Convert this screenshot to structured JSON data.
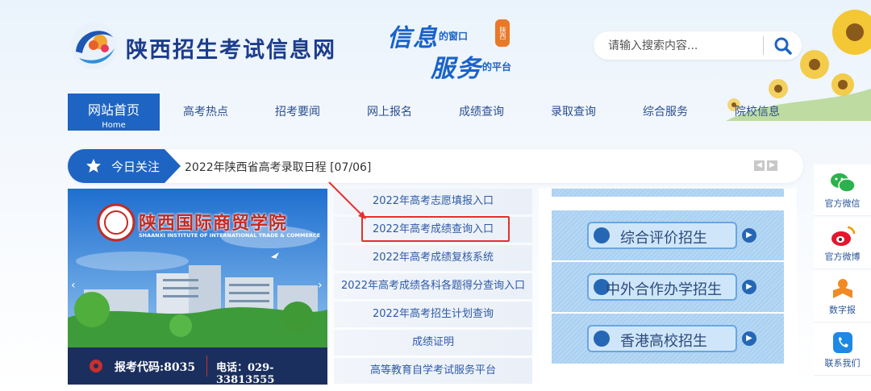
{
  "site": {
    "title": "陕西招生考试信息网",
    "slogan_line1_big": "信息",
    "slogan_line1_small": "的窗口",
    "slogan_line2_big": "服务",
    "slogan_line2_small": "的平台",
    "slogan_seal": "陕西"
  },
  "search": {
    "placeholder": "请输入搜索内容..."
  },
  "nav": {
    "home_cn": "网站首页",
    "home_en": "Home",
    "items": [
      "高考热点",
      "招考要闻",
      "网上报名",
      "成绩查询",
      "录取查询",
      "综合服务",
      "院校信息"
    ]
  },
  "focus": {
    "label": "今日关注",
    "news": "2022年陕西省高考录取日程  [07/06]"
  },
  "banner": {
    "school_cn": "陕西国际商贸学院",
    "school_en": "SHAANXI INSTITUTE OF INTERNATIONAL TRADE & COMMERCE",
    "code_text": "报考代码:8035",
    "phone_text": "电话：029-33813555"
  },
  "links": [
    "2022年高考志愿填报入口",
    "2022年高考成绩查询入口",
    "2022年高考成绩复核系统",
    "2022年高考成绩各科各题得分查询入口",
    "2022年高考招生计划查询",
    "成绩证明",
    "高等教育自学考试服务平台"
  ],
  "right_panel": {
    "buttons": [
      "综合评价招生",
      "中外合作办学招生",
      "香港高校招生"
    ]
  },
  "side": {
    "items": [
      "官方微信",
      "官方微博",
      "数字报",
      "联系我们"
    ]
  },
  "colors": {
    "primary": "#1e64c3",
    "title": "#1c3c8c",
    "link": "#2e5aa5",
    "highlight": "#e53030"
  }
}
